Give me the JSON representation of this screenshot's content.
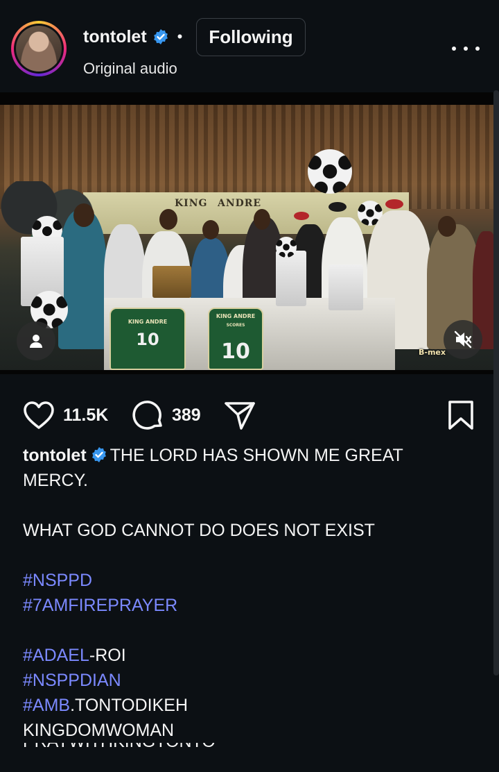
{
  "post": {
    "username": "tontolet",
    "audio": "Original audio",
    "follow_label": "Following",
    "separator": "•"
  },
  "media": {
    "banner_left": "KING",
    "banner_right": "ANDRE",
    "jersey_left_caption": "KING ANDRE",
    "jersey_left_number": "10",
    "jersey_right_caption": "KING ANDRE",
    "jersey_right_sub": "SCORES",
    "jersey_right_number": "10",
    "watermark": "B-mex",
    "muted": true
  },
  "actions": {
    "likes": "11.5K",
    "comments": "389"
  },
  "caption": {
    "username": "tontolet",
    "line1": "THE LORD HAS SHOWN ME GREAT",
    "line2": "MERCY.",
    "line3": "WHAT GOD CANNOT DO DOES NOT EXIST",
    "tag_nsppd": "#NSPPD",
    "tag_7am": "#7AMFIREPRAYER",
    "tag_adael": "#ADAEL",
    "adael_rest": "-ROI",
    "tag_nsppdian": "#NSPPDIAN",
    "tag_amb": "#AMB",
    "amb_rest": ".TONTODIKEH",
    "line_kingdom": "KINGDOMWOMAN",
    "line_pray": "PRAYWITHKINGTONTO"
  },
  "colors": {
    "background": "#0c1014",
    "hashtag": "#7b89ff",
    "verified": "#3897f0"
  }
}
